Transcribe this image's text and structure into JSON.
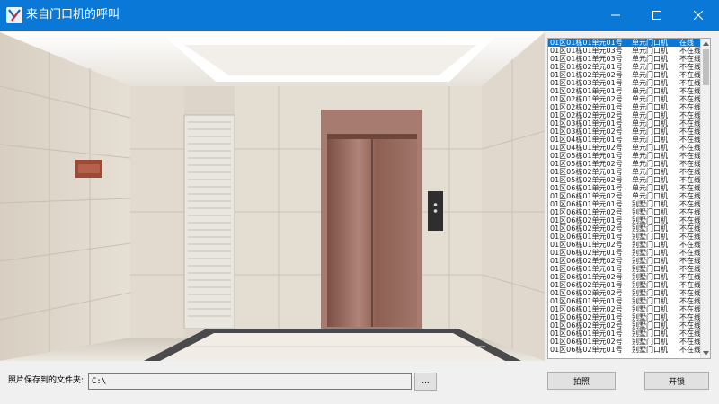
{
  "window": {
    "title": "来自门口机的呼叫"
  },
  "list": {
    "items": [
      {
        "id": "01区01栋01单元01号",
        "type": "单元门口机",
        "status": "在线",
        "selected": true
      },
      {
        "id": "01区01栋01单元03号",
        "type": "单元门口机",
        "status": "不在线"
      },
      {
        "id": "01区01栋01单元03号",
        "type": "单元门口机",
        "status": "不在线"
      },
      {
        "id": "01区01栋02单元01号",
        "type": "单元门口机",
        "status": "不在线"
      },
      {
        "id": "01区01栋02单元02号",
        "type": "单元门口机",
        "status": "不在线"
      },
      {
        "id": "01区01栋03单元01号",
        "type": "单元门口机",
        "status": "不在线"
      },
      {
        "id": "01区02栋01单元01号",
        "type": "单元门口机",
        "status": "不在线"
      },
      {
        "id": "01区02栋01单元02号",
        "type": "单元门口机",
        "status": "不在线"
      },
      {
        "id": "01区02栋02单元01号",
        "type": "单元门口机",
        "status": "不在线"
      },
      {
        "id": "01区02栋02单元02号",
        "type": "单元门口机",
        "status": "不在线"
      },
      {
        "id": "01区03栋01单元01号",
        "type": "单元门口机",
        "status": "不在线"
      },
      {
        "id": "01区03栋01单元02号",
        "type": "单元门口机",
        "status": "不在线"
      },
      {
        "id": "01区04栋01单元01号",
        "type": "单元门口机",
        "status": "不在线"
      },
      {
        "id": "01区04栋01单元02号",
        "type": "单元门口机",
        "status": "不在线"
      },
      {
        "id": "01区05栋01单元01号",
        "type": "单元门口机",
        "status": "不在线"
      },
      {
        "id": "01区05栋01单元02号",
        "type": "单元门口机",
        "status": "不在线"
      },
      {
        "id": "01区05栋02单元01号",
        "type": "单元门口机",
        "status": "不在线"
      },
      {
        "id": "01区05栋02单元02号",
        "type": "单元门口机",
        "status": "不在线"
      },
      {
        "id": "01区06栋01单元01号",
        "type": "单元门口机",
        "status": "不在线"
      },
      {
        "id": "01区06栋01单元02号",
        "type": "单元门口机",
        "status": "不在线"
      },
      {
        "id": "01区06栋01单元01号",
        "type": "别墅门口机",
        "status": "不在线"
      },
      {
        "id": "01区06栋01单元02号",
        "type": "别墅门口机",
        "status": "不在线"
      },
      {
        "id": "01区06栋02单元01号",
        "type": "别墅门口机",
        "status": "不在线"
      },
      {
        "id": "01区06栋02单元02号",
        "type": "别墅门口机",
        "status": "不在线"
      },
      {
        "id": "01区06栋01单元01号",
        "type": "别墅门口机",
        "status": "不在线"
      },
      {
        "id": "01区06栋01单元02号",
        "type": "别墅门口机",
        "status": "不在线"
      },
      {
        "id": "01区06栋02单元01号",
        "type": "别墅门口机",
        "status": "不在线"
      },
      {
        "id": "01区06栋02单元02号",
        "type": "别墅门口机",
        "status": "不在线"
      },
      {
        "id": "01区06栋01单元01号",
        "type": "别墅门口机",
        "status": "不在线"
      },
      {
        "id": "01区06栋01单元02号",
        "type": "别墅门口机",
        "status": "不在线"
      },
      {
        "id": "01区06栋02单元01号",
        "type": "别墅门口机",
        "status": "不在线"
      },
      {
        "id": "01区06栋02单元02号",
        "type": "别墅门口机",
        "status": "不在线"
      },
      {
        "id": "01区06栋01单元01号",
        "type": "别墅门口机",
        "status": "不在线"
      },
      {
        "id": "01区06栋01单元02号",
        "type": "别墅门口机",
        "status": "不在线"
      },
      {
        "id": "01区06栋02单元01号",
        "type": "别墅门口机",
        "status": "不在线"
      },
      {
        "id": "01区06栋02单元02号",
        "type": "别墅门口机",
        "status": "不在线"
      },
      {
        "id": "01区06栋01单元01号",
        "type": "别墅门口机",
        "status": "不在线"
      },
      {
        "id": "01区06栋01单元02号",
        "type": "别墅门口机",
        "status": "不在线"
      },
      {
        "id": "01区06栋02单元01号",
        "type": "别墅门口机",
        "status": "不在线"
      }
    ]
  },
  "footer": {
    "folder_label": "照片保存到的文件夹:",
    "folder_path": "C:\\",
    "browse_label": "...",
    "capture_label": "拍照",
    "unlock_label": "开锁"
  },
  "colors": {
    "titlebar": "#0a78d7",
    "selection": "#0a78d7",
    "plaque": "#9c4a36"
  },
  "icons": {
    "app": "app-logo-icon",
    "minimize": "minimize-icon",
    "maximize": "maximize-icon",
    "close": "close-icon"
  }
}
